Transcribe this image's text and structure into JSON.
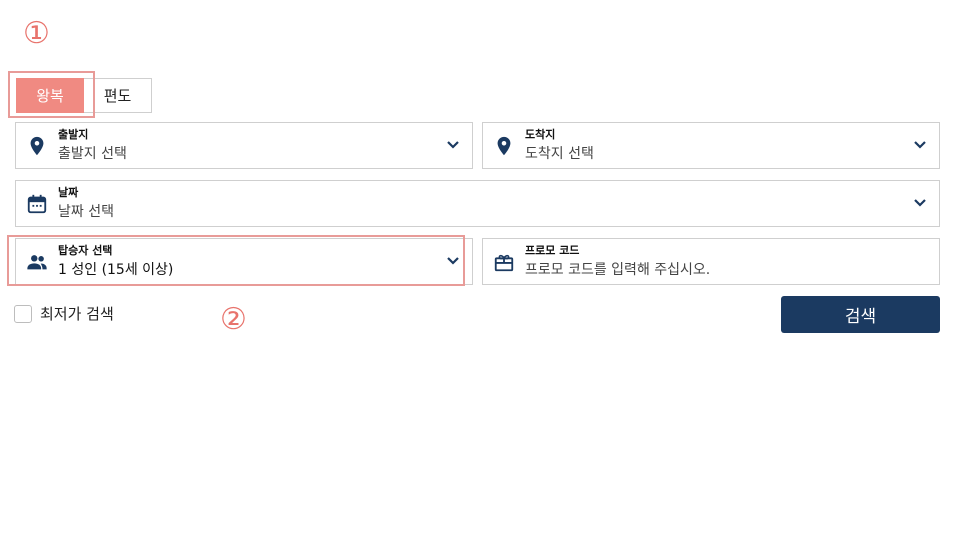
{
  "annotations": {
    "marker_1": "①",
    "marker_2": "②"
  },
  "trip_type": {
    "round_trip": "왕복",
    "one_way": "편도"
  },
  "origin": {
    "label": "출발지",
    "value": "출발지 선택",
    "icon": "location-pin-icon"
  },
  "destination": {
    "label": "도착지",
    "value": "도착지 선택",
    "icon": "location-pin-icon"
  },
  "date": {
    "label": "날짜",
    "value": "날짜 선택",
    "icon": "calendar-icon"
  },
  "passengers": {
    "label": "탑승자 선택",
    "value": "1 성인 (15세 이상)",
    "icon": "people-icon"
  },
  "promo": {
    "label": "프로모 코드",
    "value": "프로모 코드를 입력해 주십시오.",
    "icon": "gift-icon"
  },
  "lowest_fare": {
    "label": "최저가 검색",
    "checked": false
  },
  "search_button": {
    "label": "검색"
  },
  "colors": {
    "accent": "#f08a82",
    "highlight": "#e89b98",
    "primary": "#1b3a61",
    "icon": "#1b3a61"
  }
}
